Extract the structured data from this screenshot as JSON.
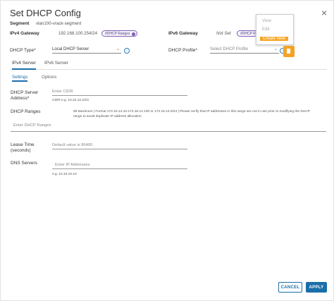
{
  "dialog": {
    "title": "Set DHCP Config",
    "close_glyph": "×"
  },
  "segment": {
    "label": "Segment",
    "value": "vlan100-vrack-segment"
  },
  "ipv4_gateway": {
    "label": "IPv4 Gateway",
    "value": "192.168.100.254/24",
    "tag": "#DHCP Ranges"
  },
  "ipv6_gateway": {
    "label": "IPv6 Gateway",
    "value": "Not Set",
    "tag": "#DHCP R"
  },
  "dhcp_type": {
    "label": "DHCP Type*",
    "value": "Local DHCP Server"
  },
  "dhcp_profile": {
    "label": "DHCP Profile*",
    "placeholder": "Select DHCP Profile"
  },
  "tabs": [
    {
      "label": "IPv4 Server"
    },
    {
      "label": "IPv6 Server"
    }
  ],
  "subtabs": [
    {
      "label": "Settings"
    },
    {
      "label": "Options"
    }
  ],
  "server_address": {
    "label_line1": "DHCP Server",
    "label_line2": "Address*",
    "placeholder": "Enter CIDR",
    "hint": "CIDR e.g. 10.22.12.2/23"
  },
  "dhcp_ranges": {
    "label": "DHCP Ranges",
    "placeholder": "Enter DHCP Ranges",
    "hint_line1": "99 Maximum | Format 172.16.14.10-172.16.14.100 or 172.16.14.0/24 | Please verify that IP addresses in this range are not in use prior to modifying the DHCP",
    "hint_line2": "range to avoid duplicate IP address allocation"
  },
  "lease_time": {
    "label_line1": "Lease Time",
    "label_line2": "(seconds)",
    "placeholder": "Default value is 86400"
  },
  "dns_servers": {
    "label": "DNS Servers",
    "placeholder": "Enter IP Addresses",
    "hint": "e.g. 10.10.10.10"
  },
  "menu": {
    "items": [
      {
        "label": "View"
      },
      {
        "label": "Edit"
      },
      {
        "label": "Create New"
      }
    ]
  },
  "footer": {
    "cancel_label": "CANCEL",
    "apply_label": "APPLY"
  },
  "colors": {
    "accent": "#1a6ea8",
    "menu_highlight": "#f5a524",
    "tag_border": "#7b5fb3"
  }
}
